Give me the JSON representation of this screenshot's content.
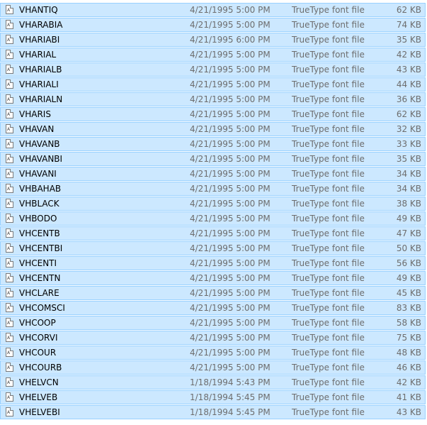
{
  "files": [
    {
      "name": "VHANTIQ",
      "date": "4/21/1995 5:00 PM",
      "type": "TrueType font file",
      "size": "62 KB"
    },
    {
      "name": "VHARABIA",
      "date": "4/21/1995 5:00 PM",
      "type": "TrueType font file",
      "size": "74 KB"
    },
    {
      "name": "VHARIABI",
      "date": "4/21/1995 6:00 PM",
      "type": "TrueType font file",
      "size": "35 KB"
    },
    {
      "name": "VHARIAL",
      "date": "4/21/1995 5:00 PM",
      "type": "TrueType font file",
      "size": "42 KB"
    },
    {
      "name": "VHARIALB",
      "date": "4/21/1995 5:00 PM",
      "type": "TrueType font file",
      "size": "43 KB"
    },
    {
      "name": "VHARIALI",
      "date": "4/21/1995 5:00 PM",
      "type": "TrueType font file",
      "size": "44 KB"
    },
    {
      "name": "VHARIALN",
      "date": "4/21/1995 5:00 PM",
      "type": "TrueType font file",
      "size": "36 KB"
    },
    {
      "name": "VHARIS",
      "date": "4/21/1995 5:00 PM",
      "type": "TrueType font file",
      "size": "62 KB"
    },
    {
      "name": "VHAVAN",
      "date": "4/21/1995 5:00 PM",
      "type": "TrueType font file",
      "size": "32 KB"
    },
    {
      "name": "VHAVANB",
      "date": "4/21/1995 5:00 PM",
      "type": "TrueType font file",
      "size": "33 KB"
    },
    {
      "name": "VHAVANBI",
      "date": "4/21/1995 5:00 PM",
      "type": "TrueType font file",
      "size": "35 KB"
    },
    {
      "name": "VHAVANI",
      "date": "4/21/1995 5:00 PM",
      "type": "TrueType font file",
      "size": "34 KB"
    },
    {
      "name": "VHBAHAB",
      "date": "4/21/1995 5:00 PM",
      "type": "TrueType font file",
      "size": "34 KB"
    },
    {
      "name": "VHBLACK",
      "date": "4/21/1995 5:00 PM",
      "type": "TrueType font file",
      "size": "38 KB"
    },
    {
      "name": "VHBODO",
      "date": "4/21/1995 5:00 PM",
      "type": "TrueType font file",
      "size": "49 KB"
    },
    {
      "name": "VHCENTB",
      "date": "4/21/1995 5:00 PM",
      "type": "TrueType font file",
      "size": "47 KB"
    },
    {
      "name": "VHCENTBI",
      "date": "4/21/1995 5:00 PM",
      "type": "TrueType font file",
      "size": "50 KB"
    },
    {
      "name": "VHCENTI",
      "date": "4/21/1995 5:00 PM",
      "type": "TrueType font file",
      "size": "56 KB"
    },
    {
      "name": "VHCENTN",
      "date": "4/21/1995 5:00 PM",
      "type": "TrueType font file",
      "size": "49 KB"
    },
    {
      "name": "VHCLARE",
      "date": "4/21/1995 5:00 PM",
      "type": "TrueType font file",
      "size": "45 KB"
    },
    {
      "name": "VHCOMSCI",
      "date": "4/21/1995 5:00 PM",
      "type": "TrueType font file",
      "size": "83 KB"
    },
    {
      "name": "VHCOOP",
      "date": "4/21/1995 5:00 PM",
      "type": "TrueType font file",
      "size": "58 KB"
    },
    {
      "name": "VHCORVI",
      "date": "4/21/1995 5:00 PM",
      "type": "TrueType font file",
      "size": "75 KB"
    },
    {
      "name": "VHCOUR",
      "date": "4/21/1995 5:00 PM",
      "type": "TrueType font file",
      "size": "48 KB"
    },
    {
      "name": "VHCOURB",
      "date": "4/21/1995 5:00 PM",
      "type": "TrueType font file",
      "size": "46 KB"
    },
    {
      "name": "VHELVCN",
      "date": "1/18/1994 5:43 PM",
      "type": "TrueType font file",
      "size": "42 KB"
    },
    {
      "name": "VHELVEB",
      "date": "1/18/1994 5:45 PM",
      "type": "TrueType font file",
      "size": "41 KB"
    },
    {
      "name": "VHELVEBI",
      "date": "1/18/1994 5:45 PM",
      "type": "TrueType font file",
      "size": "43 KB"
    }
  ],
  "icon": {
    "name": "truetype-font-file-icon",
    "glyph": "A"
  },
  "colors": {
    "selection_fill": "#cce8ff",
    "selection_border": "#99d1ff",
    "secondary_text": "#6d6d6d"
  }
}
